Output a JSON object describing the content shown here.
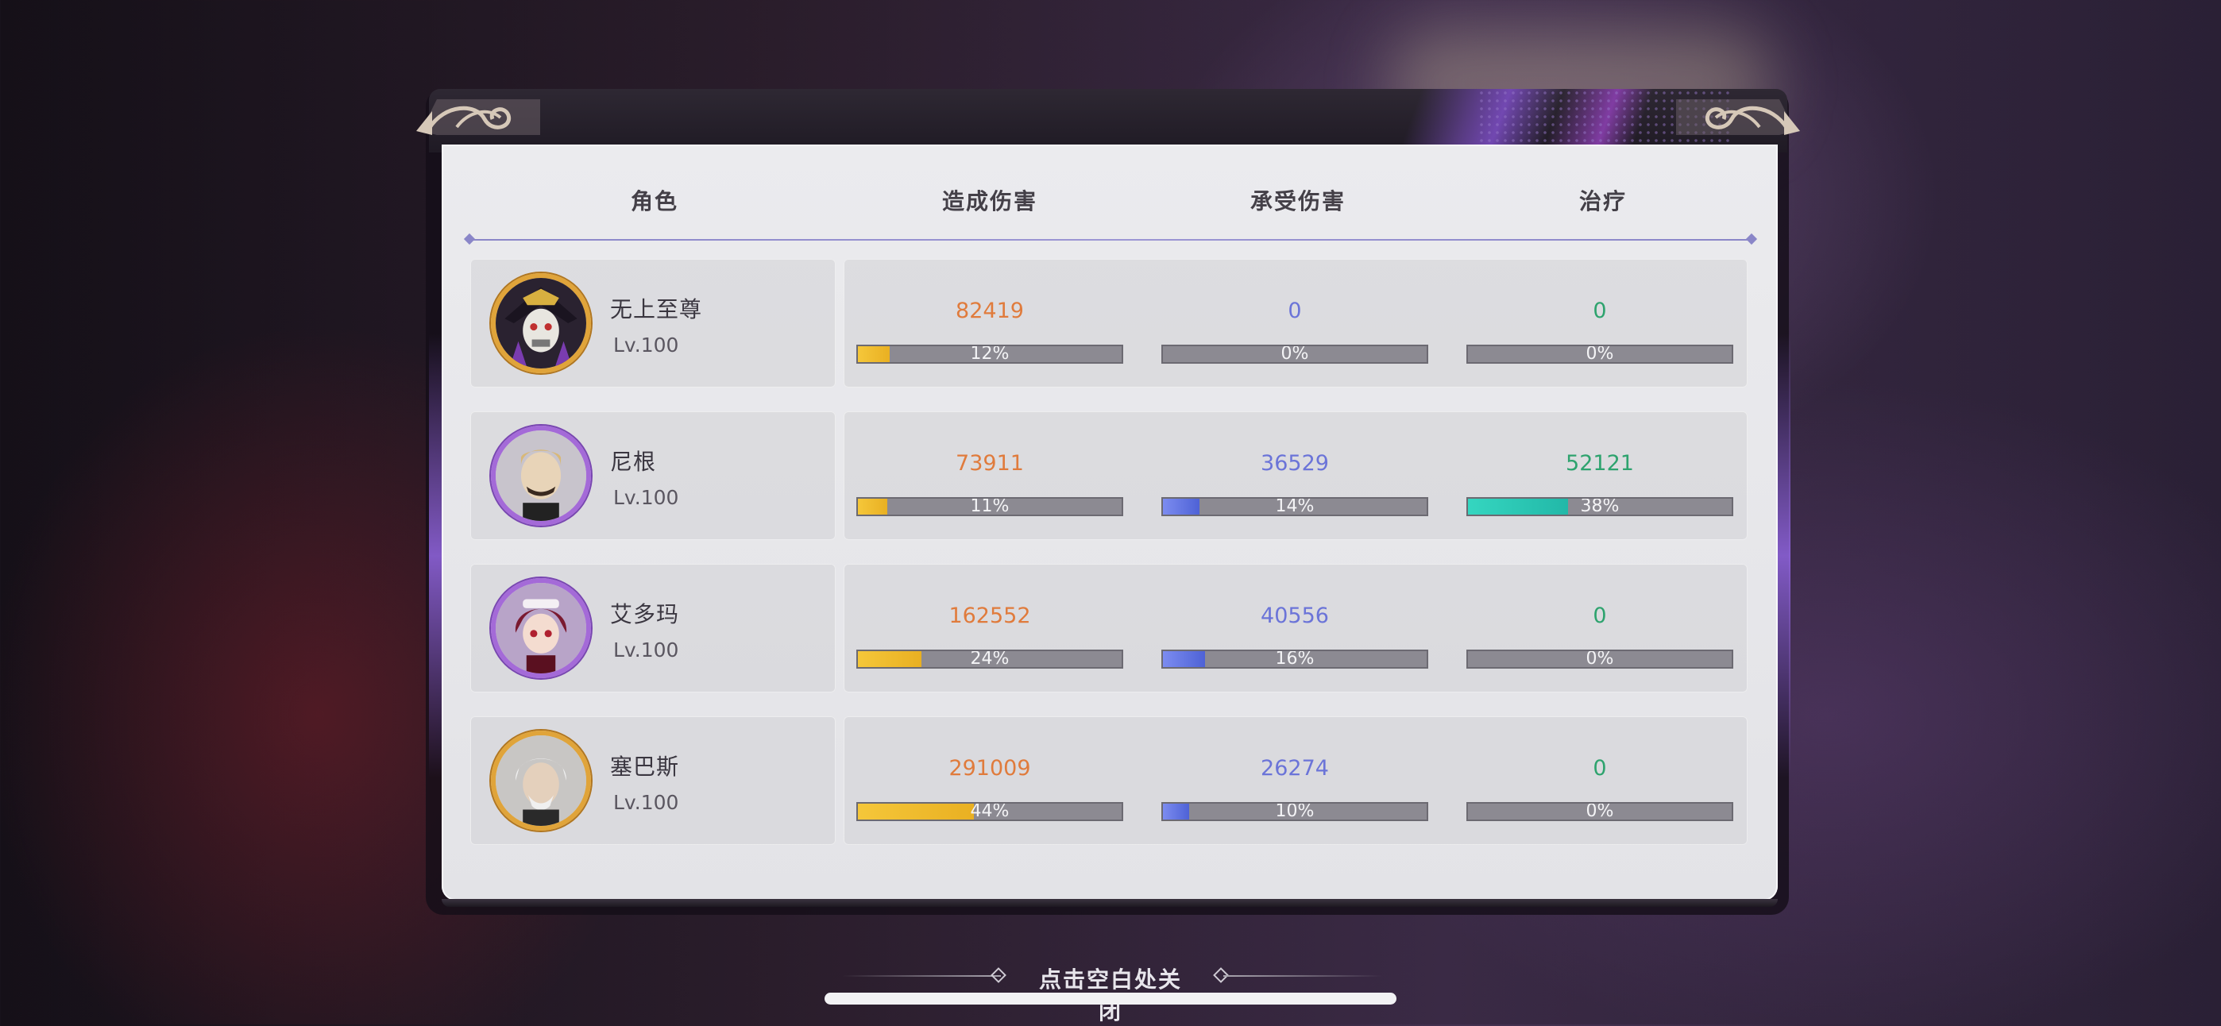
{
  "header": {
    "col_character": "角色",
    "col_damage_dealt": "造成伤害",
    "col_damage_taken": "承受伤害",
    "col_healing": "治疗"
  },
  "rows": [
    {
      "name": "无上至尊",
      "level": "Lv.100",
      "frame": "gold",
      "damage_dealt": {
        "value": "82419",
        "percent": "12%",
        "fraction": 0.12
      },
      "damage_taken": {
        "value": "0",
        "percent": "0%",
        "fraction": 0
      },
      "healing": {
        "value": "0",
        "percent": "0%",
        "fraction": 0
      }
    },
    {
      "name": "尼根",
      "level": "Lv.100",
      "frame": "purple",
      "damage_dealt": {
        "value": "73911",
        "percent": "11%",
        "fraction": 0.11
      },
      "damage_taken": {
        "value": "36529",
        "percent": "14%",
        "fraction": 0.14
      },
      "healing": {
        "value": "52121",
        "percent": "38%",
        "fraction": 0.38
      }
    },
    {
      "name": "艾多玛",
      "level": "Lv.100",
      "frame": "purple",
      "damage_dealt": {
        "value": "162552",
        "percent": "24%",
        "fraction": 0.24
      },
      "damage_taken": {
        "value": "40556",
        "percent": "16%",
        "fraction": 0.16
      },
      "healing": {
        "value": "0",
        "percent": "0%",
        "fraction": 0
      }
    },
    {
      "name": "塞巴斯",
      "level": "Lv.100",
      "frame": "gold",
      "damage_dealt": {
        "value": "291009",
        "percent": "44%",
        "fraction": 0.44
      },
      "damage_taken": {
        "value": "26274",
        "percent": "10%",
        "fraction": 0.1
      },
      "healing": {
        "value": "0",
        "percent": "0%",
        "fraction": 0
      }
    }
  ],
  "footer": {
    "close_hint": "点击空白处关闭"
  },
  "colors": {
    "damage_dealt": "#e07b3c",
    "damage_taken": "#6b74d8",
    "healing": "#2ea36e",
    "gold_frame": "#e0a43a",
    "purple_frame": "#a46ad8"
  },
  "icons": [
    "character-portrait",
    "ornament-corner",
    "diamond-icon"
  ]
}
